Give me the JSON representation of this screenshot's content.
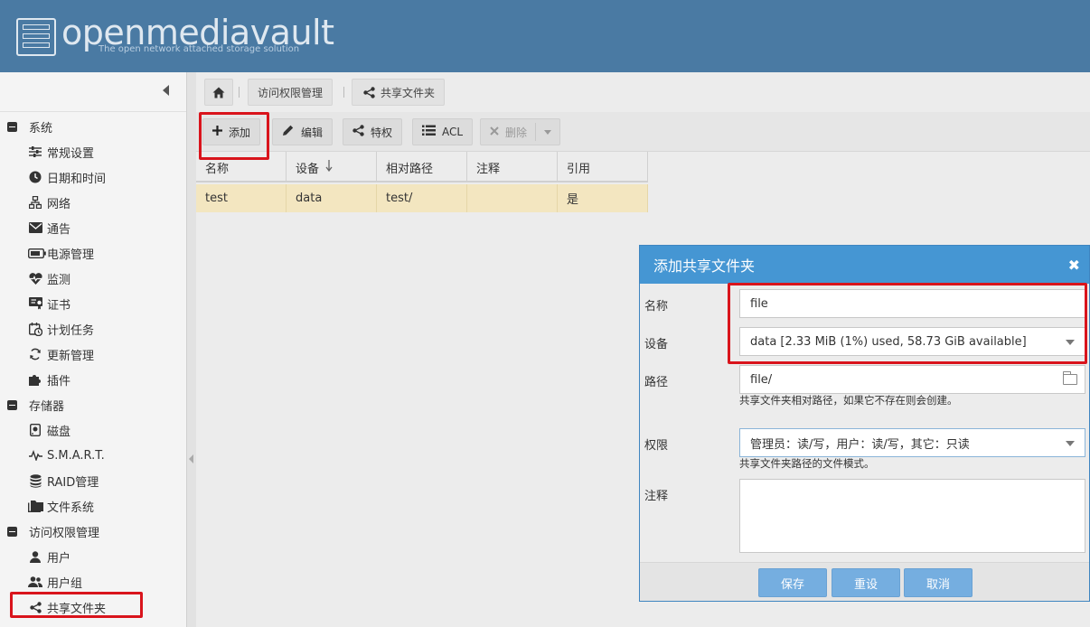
{
  "header": {
    "logo_title": "openmediavault",
    "logo_subtitle": "The open network attached storage solution"
  },
  "sidebar": {
    "groups": [
      {
        "label": "系统",
        "items": [
          {
            "label": "常规设置",
            "icon": "sliders-icon"
          },
          {
            "label": "日期和时间",
            "icon": "clock-icon"
          },
          {
            "label": "网络",
            "icon": "network-icon"
          },
          {
            "label": "通告",
            "icon": "envelope-icon"
          },
          {
            "label": "电源管理",
            "icon": "battery-icon"
          },
          {
            "label": "监测",
            "icon": "heartbeat-icon"
          },
          {
            "label": "证书",
            "icon": "certificate-icon"
          },
          {
            "label": "计划任务",
            "icon": "calendar-clock-icon"
          },
          {
            "label": "更新管理",
            "icon": "refresh-icon"
          },
          {
            "label": "插件",
            "icon": "puzzle-icon"
          }
        ]
      },
      {
        "label": "存储器",
        "items": [
          {
            "label": "磁盘",
            "icon": "disk-icon"
          },
          {
            "label": "S.M.A.R.T.",
            "icon": "pulse-icon"
          },
          {
            "label": "RAID管理",
            "icon": "database-icon"
          },
          {
            "label": "文件系统",
            "icon": "folders-icon"
          }
        ]
      },
      {
        "label": "访问权限管理",
        "items": [
          {
            "label": "用户",
            "icon": "user-icon"
          },
          {
            "label": "用户组",
            "icon": "users-icon"
          },
          {
            "label": "共享文件夹",
            "icon": "share-icon"
          }
        ]
      }
    ]
  },
  "breadcrumb": {
    "items": [
      "访问权限管理",
      "共享文件夹"
    ]
  },
  "toolbar": {
    "add": "添加",
    "edit": "编辑",
    "privileges": "特权",
    "acl": "ACL",
    "delete": "删除"
  },
  "grid": {
    "columns": [
      "名称",
      "设备",
      "相对路径",
      "注释",
      "引用"
    ],
    "rows": [
      {
        "name": "test",
        "device": "data",
        "path": "test/",
        "comment": "",
        "referenced": "是"
      }
    ]
  },
  "dialog": {
    "title": "添加共享文件夹",
    "name_label": "名称",
    "name_value": "file",
    "device_label": "设备",
    "device_value": "data [2.33 MiB (1%) used, 58.73 GiB available]",
    "path_label": "路径",
    "path_value": "file/",
    "path_hint": "共享文件夹相对路径，如果它不存在则会创建。",
    "perm_label": "权限",
    "perm_value": "管理员：读/写，用户：读/写，其它：只读",
    "perm_hint": "共享文件夹路径的文件模式。",
    "comment_label": "注释",
    "save": "保存",
    "reset": "重设",
    "cancel": "取消"
  }
}
